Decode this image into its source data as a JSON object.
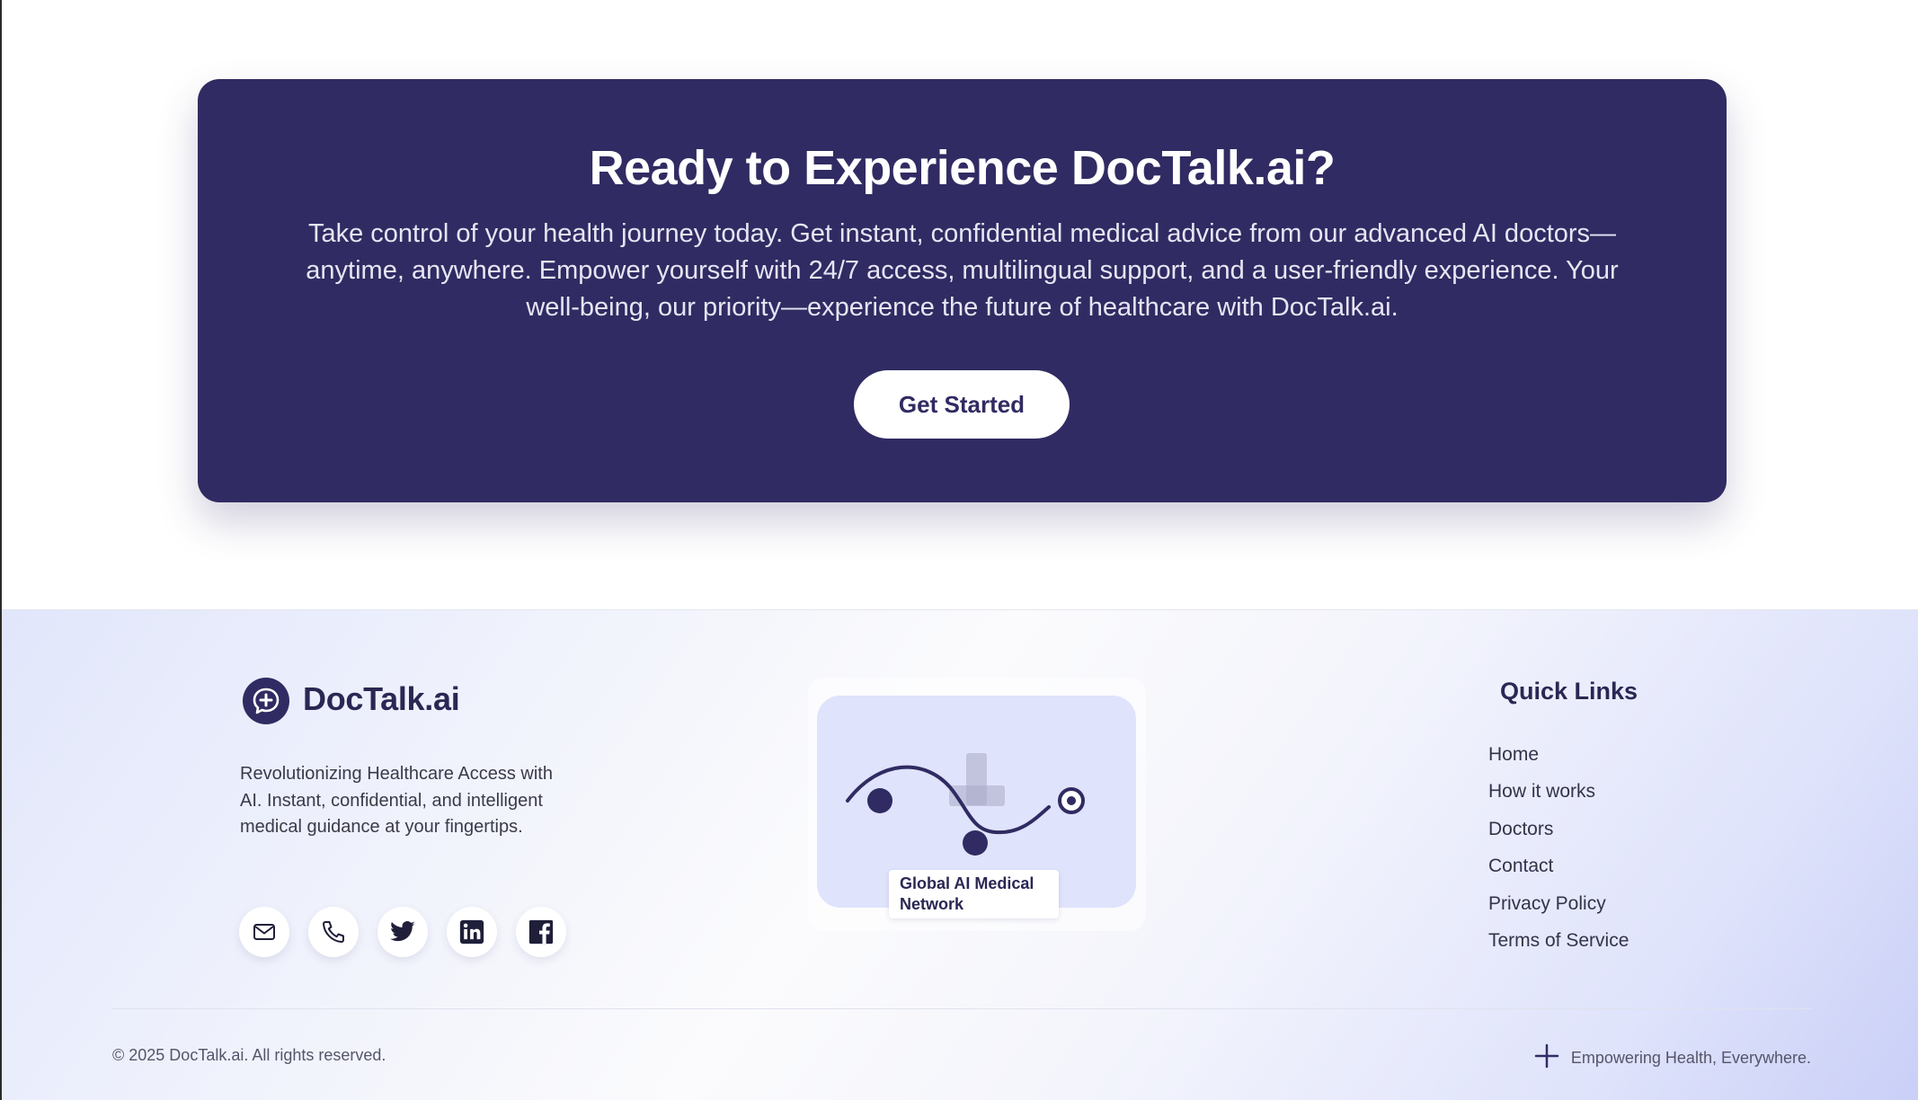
{
  "cta": {
    "title": "Ready to Experience DocTalk.ai?",
    "text": "Take control of your health journey today. Get instant, confidential medical advice from our advanced AI doctors—anytime, anywhere. Empower yourself with 24/7 access, multilingual support, and a user-friendly experience. Your well-being, our priority—experience the future of healthcare with DocTalk.ai.",
    "button_label": "Get Started"
  },
  "footer": {
    "brand": {
      "name": "DocTalk.ai",
      "logo_icon": "chat-medical-cross-icon",
      "description": "Revolutionizing Healthcare Access with AI. Instant, confidential, and intelligent medical guidance at your fingertips."
    },
    "socials": [
      {
        "icon": "mail-icon"
      },
      {
        "icon": "phone-icon"
      },
      {
        "icon": "twitter-icon"
      },
      {
        "icon": "linkedin-icon"
      },
      {
        "icon": "facebook-icon"
      }
    ],
    "network": {
      "label": "Global AI Medical Network"
    },
    "quick_links": {
      "title": "Quick Links",
      "items": [
        "Home",
        "How it works",
        "Doctors",
        "Contact",
        "Privacy Policy",
        "Terms of Service"
      ]
    },
    "copyright": "© 2025 DocTalk.ai. All rights reserved.",
    "tagline": "Empowering Health, Everywhere.",
    "tagline_icon": "plus-icon"
  },
  "colors": {
    "primary": "#302b62",
    "text_dark": "#2a2754",
    "footer_bg_light": "#f2f4fc",
    "footer_bg_accent": "#c9cff7"
  }
}
